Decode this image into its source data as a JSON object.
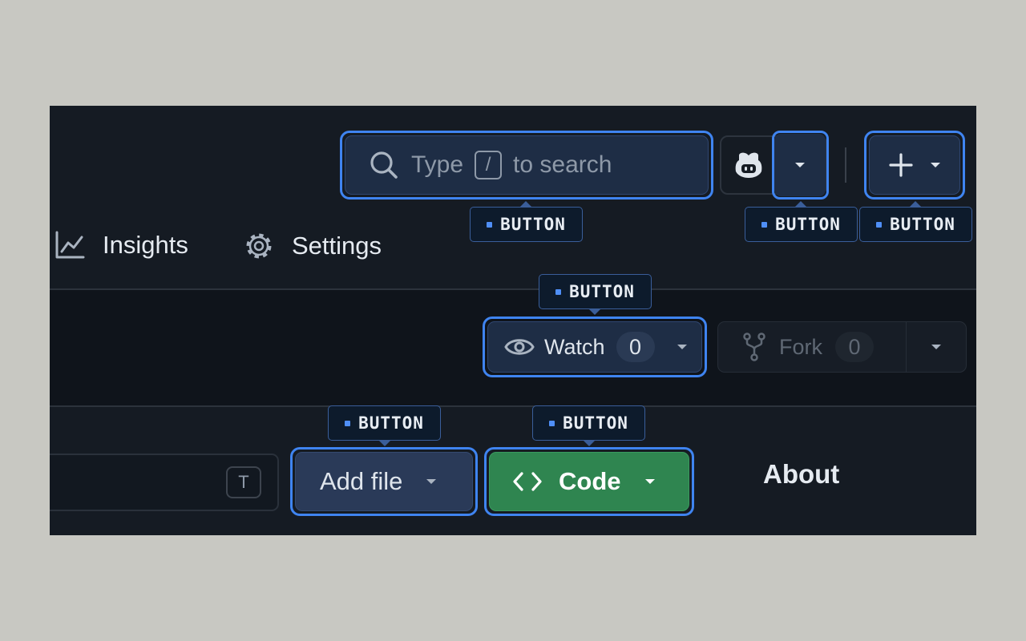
{
  "header": {
    "search": {
      "type_word": "Type",
      "shortcut_key": "/",
      "rest": "to search"
    }
  },
  "repo_nav": {
    "insights_label": "Insights",
    "settings_label": "Settings"
  },
  "repo_actions": {
    "watch_label": "Watch",
    "watch_count": "0",
    "fork_label": "Fork",
    "fork_count": "0"
  },
  "file_bar": {
    "filter_shortcut": "T",
    "add_file_label": "Add file",
    "code_label": "Code",
    "about_label": "About"
  },
  "annotations": {
    "label": "BUTTON"
  },
  "colors": {
    "highlight": "#3f84f0",
    "code_button": "#2f8550",
    "panel": "#151b23"
  }
}
